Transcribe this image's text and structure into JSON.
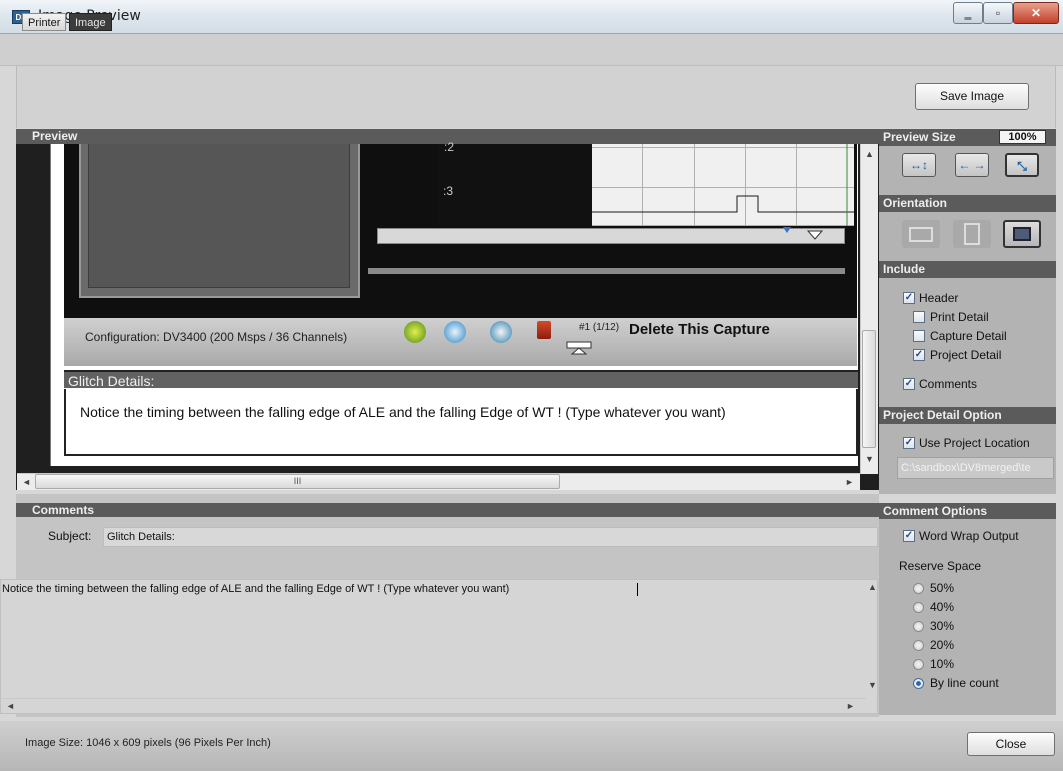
{
  "window": {
    "title": "Image Preview",
    "app_icon": "DS"
  },
  "tabs": [
    {
      "label": "Printer"
    },
    {
      "label": "Image"
    }
  ],
  "toolbar": {
    "save_label": "Save Image"
  },
  "preview": {
    "header": "Preview",
    "row_labels": [
      ":2",
      ":3"
    ],
    "config_label": "Configuration:  DV3400 (200 Msps / 36 Channels)",
    "capture_num": "#1 (1/12)",
    "delete_label": "Delete This Capture",
    "glitch_header": "Glitch Details:",
    "glitch_text": "Notice the timing between the falling edge of ALE and the falling Edge of WT ! (Type whatever you want)",
    "hscroll_grip": "III"
  },
  "preview_size": {
    "header": "Preview Size",
    "zoom": "100%"
  },
  "orientation": {
    "header": "Orientation"
  },
  "include": {
    "header": "Include",
    "items": [
      {
        "label": "Header",
        "checked": true
      },
      {
        "label": "Print Detail",
        "checked": false
      },
      {
        "label": "Capture Detail",
        "checked": false
      },
      {
        "label": "Project Detail",
        "checked": true
      },
      {
        "label": "Comments",
        "checked": true
      }
    ]
  },
  "project_detail_option": {
    "header": "Project Detail Option",
    "use_location_label": "Use Project Location",
    "use_location_checked": true,
    "path": "C:\\sandbox\\DV8merged\\te"
  },
  "comments": {
    "header": "Comments",
    "subject_label": "Subject:",
    "subject_value": "Glitch Details:",
    "body": "Notice the timing between the falling edge of ALE and the falling Edge of WT ! (Type whatever you want)"
  },
  "comment_options": {
    "header": "Comment Options",
    "word_wrap_label": "Word Wrap Output",
    "word_wrap_checked": true,
    "reserve_label": "Reserve Space",
    "reserve_options": [
      "50%",
      "40%",
      "30%",
      "20%",
      "10%",
      "By line count"
    ],
    "reserve_selected": "By line count"
  },
  "status": {
    "text": "Image Size: 1046 x 609 pixels  (96 Pixels Per Inch)",
    "close_label": "Close"
  },
  "icons": {
    "check": "✓",
    "close": "✕",
    "minimize": "‗",
    "maximize": "▫",
    "scroll_up": "▲",
    "scroll_down": "▼",
    "scroll_left": "◄",
    "scroll_right": "►",
    "size_fit": "↔↕",
    "size_width": "← →",
    "size_actual": "⤡",
    "orient_landscape": "landscape-icon",
    "orient_portrait": "portrait-icon",
    "orient_auto": "auto-orientation-icon"
  }
}
